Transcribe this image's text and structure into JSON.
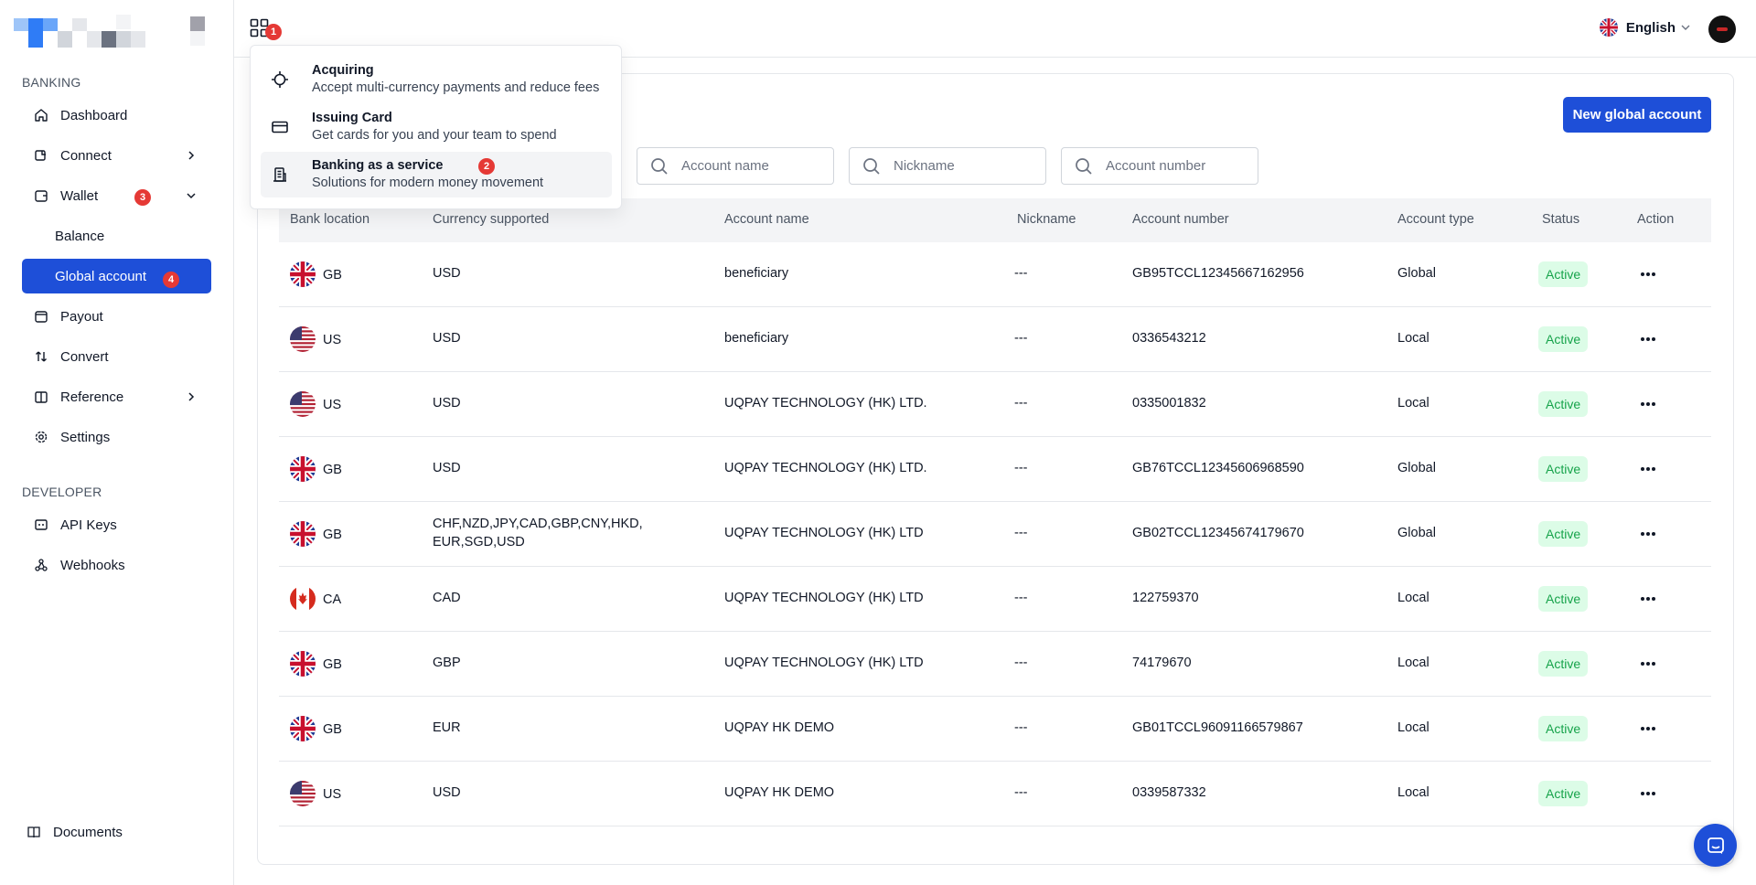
{
  "sidebar": {
    "banking_label": "BANKING",
    "developer_label": "DEVELOPER",
    "items": [
      {
        "label": "Dashboard"
      },
      {
        "label": "Connect"
      },
      {
        "label": "Wallet"
      },
      {
        "label": "Balance"
      },
      {
        "label": "Global account"
      },
      {
        "label": "Payout"
      },
      {
        "label": "Convert"
      },
      {
        "label": "Reference"
      },
      {
        "label": "Settings"
      }
    ],
    "dev_items": [
      {
        "label": "API Keys"
      },
      {
        "label": "Webhooks"
      }
    ],
    "documents_label": "Documents",
    "badges": {
      "wallet": "3",
      "global_account": "4"
    }
  },
  "topbar": {
    "apps_badge": "1",
    "language": "English"
  },
  "dropdown": {
    "items": [
      {
        "title": "Acquiring",
        "desc": "Accept multi-currency payments and reduce fees"
      },
      {
        "title": "Issuing Card",
        "desc": "Get cards for you and your team to spend"
      },
      {
        "title": "Banking as a service",
        "desc": "Solutions for modern money movement",
        "badge": "2"
      }
    ]
  },
  "main": {
    "new_button_label": "New global account",
    "search": {
      "account_name_placeholder": "Account name",
      "nickname_placeholder": "Nickname",
      "account_number_placeholder": "Account number"
    },
    "columns": [
      "Bank location",
      "Currency supported",
      "Account name",
      "Nickname",
      "Account number",
      "Account type",
      "Status",
      "Action"
    ],
    "rows": [
      {
        "location": "GB",
        "flag": "gb",
        "currency": "USD",
        "currency2": "",
        "account_name": "beneficiary",
        "nickname": "---",
        "account_number": "GB95TCCL12345667162956",
        "type": "Global",
        "status": "Active"
      },
      {
        "location": "US",
        "flag": "us",
        "currency": "USD",
        "currency2": "",
        "account_name": "beneficiary",
        "nickname": "---",
        "account_number": "0336543212",
        "type": "Local",
        "status": "Active"
      },
      {
        "location": "US",
        "flag": "us",
        "currency": "USD",
        "currency2": "",
        "account_name": "UQPAY TECHNOLOGY (HK) LTD.",
        "nickname": "---",
        "account_number": "0335001832",
        "type": "Local",
        "status": "Active"
      },
      {
        "location": "GB",
        "flag": "gb",
        "currency": "USD",
        "currency2": "",
        "account_name": "UQPAY TECHNOLOGY (HK) LTD.",
        "nickname": "---",
        "account_number": "GB76TCCL12345606968590",
        "type": "Global",
        "status": "Active"
      },
      {
        "location": "GB",
        "flag": "gb",
        "currency": "CHF,NZD,JPY,CAD,GBP,CNY,HKD,",
        "currency2": "EUR,SGD,USD",
        "account_name": "UQPAY TECHNOLOGY (HK) LTD",
        "nickname": "---",
        "account_number": "GB02TCCL12345674179670",
        "type": "Global",
        "status": "Active"
      },
      {
        "location": "CA",
        "flag": "ca",
        "currency": "CAD",
        "currency2": "",
        "account_name": "UQPAY TECHNOLOGY (HK) LTD",
        "nickname": "---",
        "account_number": "122759370",
        "type": "Local",
        "status": "Active"
      },
      {
        "location": "GB",
        "flag": "gb",
        "currency": "GBP",
        "currency2": "",
        "account_name": "UQPAY TECHNOLOGY (HK) LTD",
        "nickname": "---",
        "account_number": "74179670",
        "type": "Local",
        "status": "Active"
      },
      {
        "location": "GB",
        "flag": "gb",
        "currency": "EUR",
        "currency2": "",
        "account_name": "UQPAY HK DEMO",
        "nickname": "---",
        "account_number": "GB01TCCL96091166579867",
        "type": "Local",
        "status": "Active"
      },
      {
        "location": "US",
        "flag": "us",
        "currency": "USD",
        "currency2": "",
        "account_name": "UQPAY HK DEMO",
        "nickname": "---",
        "account_number": "0339587332",
        "type": "Local",
        "status": "Active"
      }
    ]
  },
  "colors": {
    "accent": "#1e4fd8",
    "badge": "#e53935",
    "status_bg": "#dcfce7",
    "status_text": "#16a34a"
  },
  "icons": {
    "apps": "grid-icon",
    "chat": "chat-icon"
  }
}
